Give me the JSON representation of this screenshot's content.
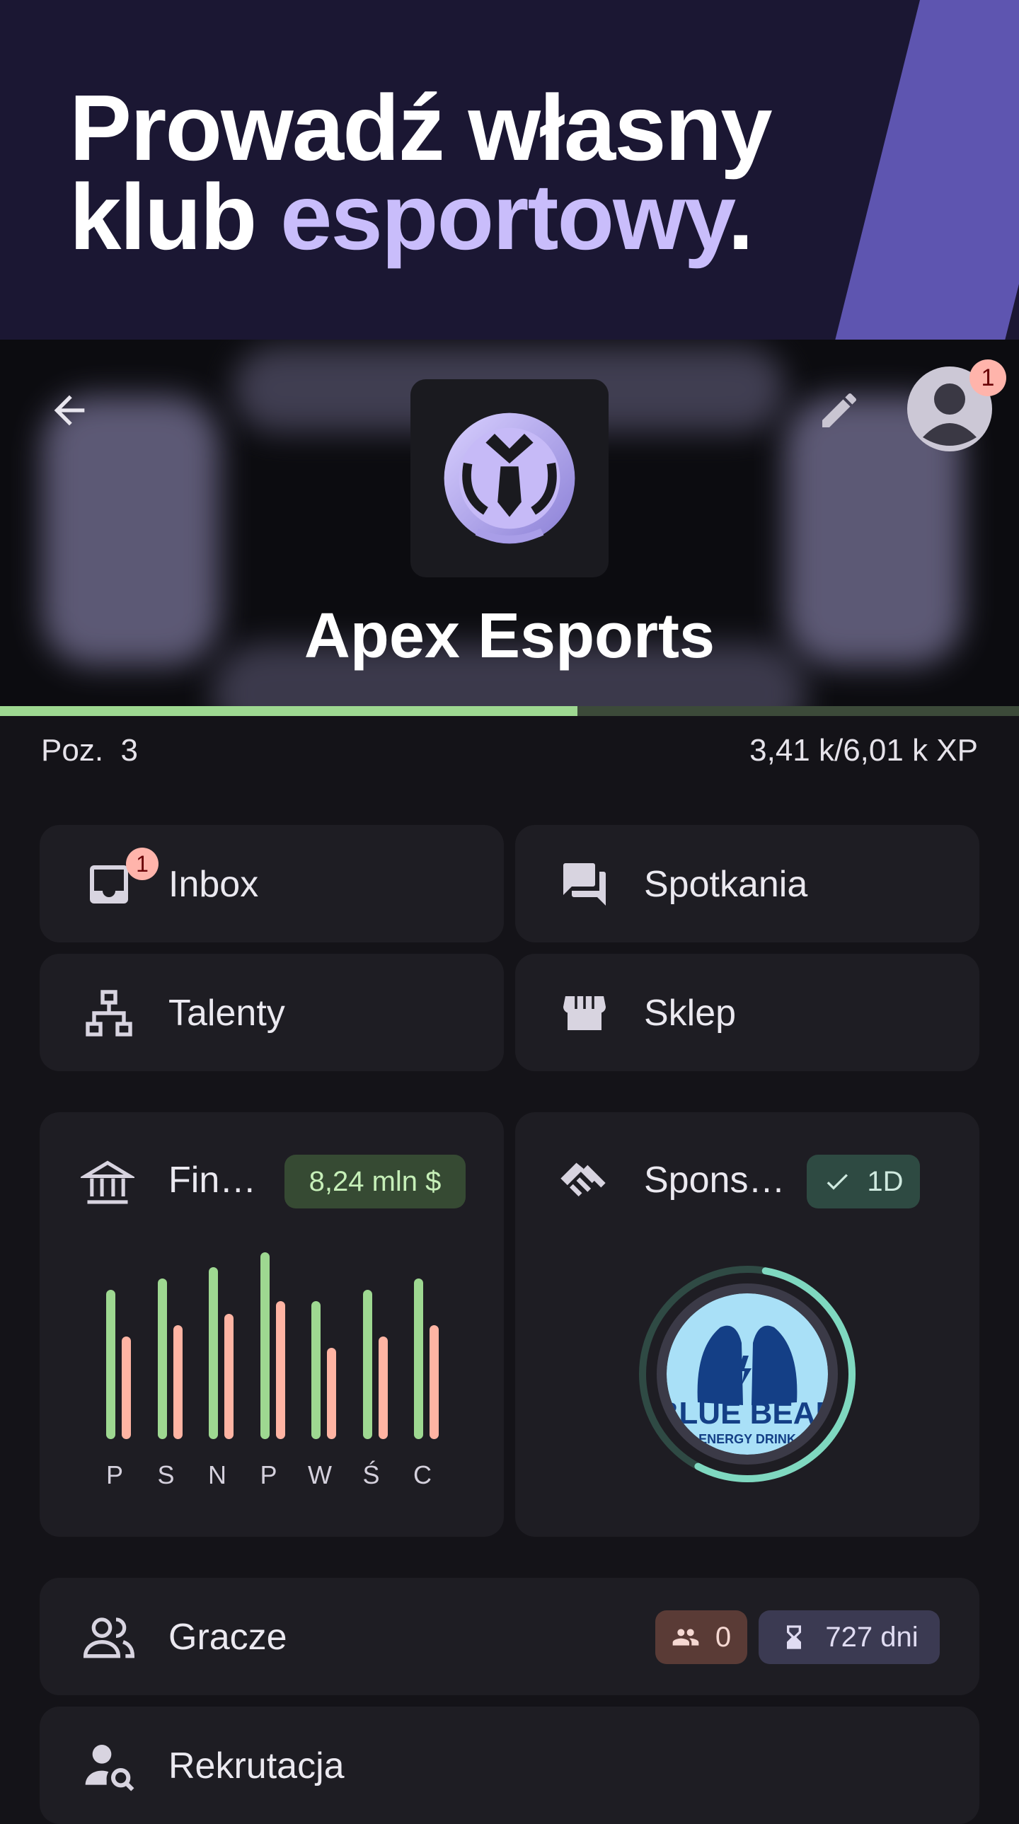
{
  "promo": {
    "line1": "Prowadź własny",
    "line2_plain": "klub ",
    "line2_accent": "esportowy",
    "line2_end": "."
  },
  "header": {
    "back_icon": "arrow-back-icon",
    "edit_icon": "pencil-icon",
    "account_icon": "account-circle-icon",
    "account_badge": "1",
    "club_name": "Apex Esports"
  },
  "progress": {
    "level_label": "Poz.  3",
    "xp_label": "3,41 k/6,01 k XP",
    "xp_fraction": 0.567
  },
  "tiles": {
    "inbox": {
      "label": "Inbox",
      "badge": "1",
      "icon": "inbox-icon"
    },
    "meetings": {
      "label": "Spotkania",
      "icon": "forum-icon"
    },
    "talents": {
      "label": "Talenty",
      "icon": "org-chart-icon"
    },
    "shop": {
      "label": "Sklep",
      "icon": "storefront-icon"
    }
  },
  "finance": {
    "label": "Fin…",
    "icon": "bank-icon",
    "amount": "8,24 mln $",
    "days": [
      "P",
      "S",
      "N",
      "P",
      "W",
      "Ś",
      "C"
    ],
    "income": [
      0.8,
      0.86,
      0.92,
      1.0,
      0.74,
      0.8,
      0.86
    ],
    "expense": [
      0.55,
      0.61,
      0.67,
      0.74,
      0.49,
      0.55,
      0.61
    ],
    "income_color": "#9ed891",
    "expense_color": "#ffb4a3"
  },
  "sponsors": {
    "label": "Spons…",
    "icon": "handshake-icon",
    "status": "1D",
    "status_icon": "check-icon",
    "logo_line1": "BLUE BEAR",
    "logo_line2": "ENERGY DRINK",
    "ring_progress": 0.55
  },
  "players": {
    "label": "Gracze",
    "icon": "group-icon",
    "count": "0",
    "count_icon": "people-icon",
    "days": "727 dni",
    "days_icon": "hourglass-icon"
  },
  "recruitment": {
    "label": "Rekrutacja",
    "icon": "person-search-icon"
  }
}
